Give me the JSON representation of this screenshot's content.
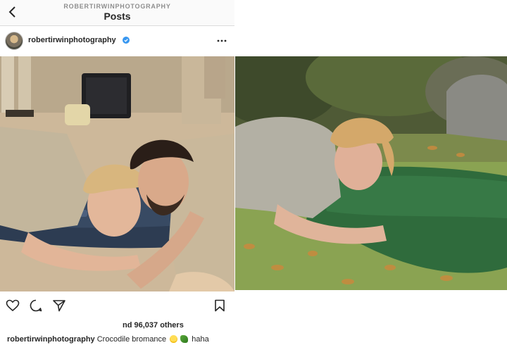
{
  "header": {
    "account_handle": "ROBERTIRWINPHOTOGRAPHY",
    "title": "Posts"
  },
  "post": {
    "username": "robertirwinphotography",
    "likes_text": "nd 96,037 others",
    "caption_user": "robertirwinphotography",
    "caption_text": "Crocodile bromance",
    "caption_tail": "haha"
  },
  "icons": [
    "back-icon",
    "verified-icon",
    "more-icon",
    "heart-icon",
    "comment-icon",
    "share-icon",
    "bookmark-icon"
  ],
  "colors": {
    "verified": "#3897f0",
    "text": "#262626",
    "muted": "#8e8e8e"
  }
}
